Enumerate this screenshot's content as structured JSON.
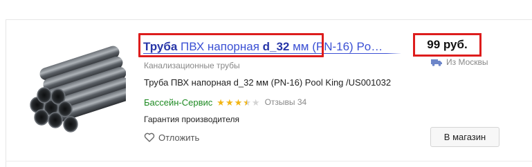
{
  "product": {
    "title_bold_1": "Труба",
    "title_plain_1": " ПВХ напорная ",
    "title_bold_2": "d_32",
    "title_plain_2": " мм (PN-16) Po…",
    "category": "Канализационные трубы",
    "description": "Труба ПВХ напорная d_32 мм (PN-16) Pool King /US001032",
    "guarantee": "Гарантия производителя",
    "image_icon": "pipes-bundle-image"
  },
  "offer": {
    "price": "99 руб.",
    "delivery": "Из Москвы",
    "delivery_icon": "truck-icon"
  },
  "shop": {
    "name": "Бассейн-Сервис",
    "rating": 3.5,
    "rating_max": 5,
    "reviews": "Отзывы 34"
  },
  "actions": {
    "save_label": "Отложить",
    "save_icon": "heart-outline-icon",
    "to_shop_label": "В магазин"
  },
  "colors": {
    "link": "#3b50d4",
    "shop": "#1d8a22",
    "star": "#f2b514",
    "highlight": "#dd1c1c"
  }
}
